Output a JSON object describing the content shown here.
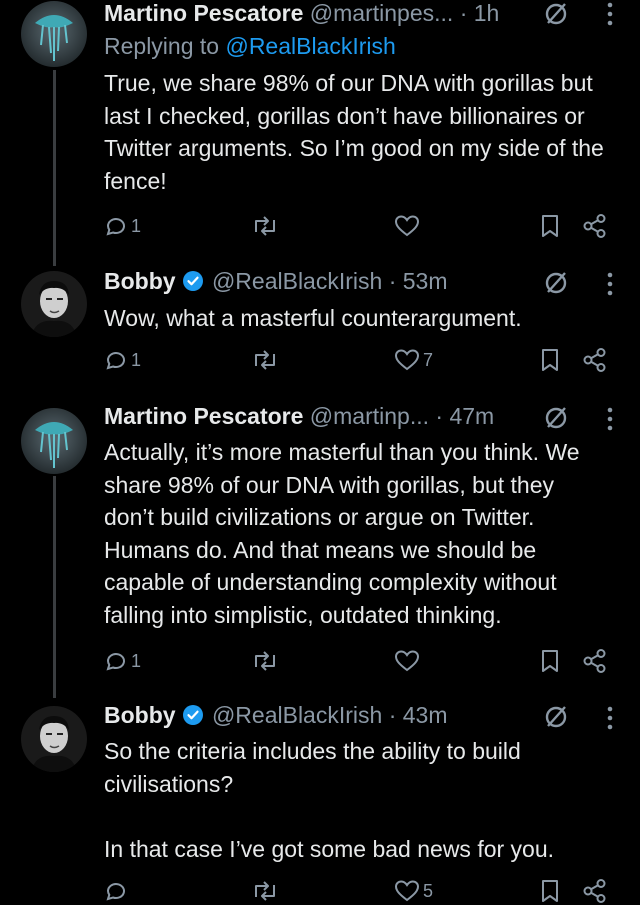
{
  "colors": {
    "background": "#000000",
    "text": "#e7e9ea",
    "muted": "#8b98a5",
    "link": "#1d9bf0",
    "verified": "#1d9bf0"
  },
  "tweets": [
    {
      "name": "Martino Pescatore",
      "handle": "@martinpes...",
      "time": "· 1h",
      "replying_prefix": "Replying to ",
      "replying_handle": "@RealBlackIrish",
      "text": "True, we share 98% of our DNA with gorillas but last I checked, gorillas don’t have billionaires or Twitter arguments. So I’m good on my side of the fence!",
      "reply_count": "1",
      "retweet_count": "",
      "like_count": "",
      "verified": false,
      "avatar_icon": "jellyfish-avatar"
    },
    {
      "name": "Bobby",
      "handle": "@RealBlackIrish",
      "time": "· 53m",
      "text": "Wow, what a masterful counterargument.",
      "reply_count": "1",
      "retweet_count": "",
      "like_count": "7",
      "verified": true,
      "avatar_icon": "portrait-avatar"
    },
    {
      "name": "Martino Pescatore",
      "handle": "@martinp...",
      "time": "· 47m",
      "text": "Actually, it’s more masterful than you think. We share 98% of our DNA with gorillas, but they don’t build civilizations or argue on Twitter. Humans do. And that means we should be capable of understanding complexity without falling into simplistic, outdated thinking.",
      "reply_count": "1",
      "retweet_count": "",
      "like_count": "",
      "verified": false,
      "avatar_icon": "jellyfish-avatar"
    },
    {
      "name": "Bobby",
      "handle": "@RealBlackIrish",
      "time": "· 43m",
      "text": "So the criteria includes the ability to build civilisations?\n\nIn that case I’ve got some bad news for you.",
      "reply_count": "",
      "retweet_count": "",
      "like_count": "5",
      "verified": true,
      "avatar_icon": "portrait-avatar"
    }
  ],
  "icons": [
    "grok-icon",
    "more-icon",
    "reply-icon",
    "retweet-icon",
    "like-icon",
    "bookmark-icon",
    "share-icon",
    "verified-icon"
  ]
}
